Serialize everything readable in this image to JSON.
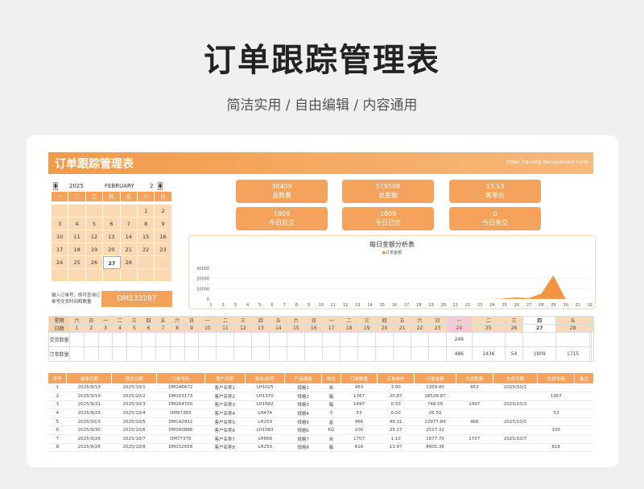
{
  "page": {
    "title": "订单跟踪管理表",
    "subtitle": "简洁实用 / 自由编辑 / 内容通用"
  },
  "sheet": {
    "title": "订单跟踪管理表",
    "title_en": "Order Tracking Management Form"
  },
  "calendar": {
    "year": "2025",
    "month": "FEBRUARY",
    "month_num": "2",
    "weekdays": [
      "一",
      "二",
      "三",
      "四",
      "五",
      "六",
      "日"
    ],
    "weeks": [
      [
        "",
        "",
        "",
        "",
        "",
        "1",
        "2"
      ],
      [
        "3",
        "4",
        "5",
        "6",
        "7",
        "8",
        "9"
      ],
      [
        "10",
        "11",
        "12",
        "13",
        "14",
        "15",
        "16"
      ],
      [
        "17",
        "18",
        "19",
        "20",
        "21",
        "22",
        "23"
      ],
      [
        "24",
        "25",
        "26",
        "27",
        "28",
        "",
        ""
      ],
      [
        "",
        "",
        "",
        "",
        "",
        "",
        ""
      ]
    ],
    "today": "27"
  },
  "lookup": {
    "label": "输入订单号，即可查询订单号交货时间和数量",
    "value": "DM133287"
  },
  "stats": [
    {
      "value": "38409",
      "label": "总数量"
    },
    {
      "value": "519508",
      "label": "总金额"
    },
    {
      "value": "13.53",
      "label": "客单价"
    },
    {
      "value": "1809",
      "label": "今日应交"
    },
    {
      "value": "1809",
      "label": "今日已交"
    },
    {
      "value": "0",
      "label": "今日未交"
    }
  ],
  "chart_data": {
    "type": "area",
    "title": "每日金额分析表",
    "legend": [
      "订单金额"
    ],
    "x": [
      "1",
      "2",
      "3",
      "4",
      "5",
      "6",
      "7",
      "8",
      "9",
      "10",
      "11",
      "12",
      "13",
      "14",
      "15",
      "16",
      "17",
      "18",
      "19",
      "20",
      "21",
      "22",
      "23",
      "24",
      "25",
      "26",
      "27",
      "28",
      "29",
      "30",
      "31",
      "32"
    ],
    "series": [
      {
        "name": "订单金额",
        "values": [
          0,
          0,
          0,
          0,
          0,
          0,
          0,
          0,
          0,
          0,
          0,
          0,
          0,
          0,
          0,
          0,
          0,
          0,
          0,
          0,
          0,
          0,
          0,
          0,
          500,
          1500,
          800,
          5000,
          23000,
          0,
          0,
          0
        ]
      }
    ],
    "yticks": [
      "0",
      "10000",
      "20000",
      "30000"
    ],
    "ylim": [
      0,
      30000
    ],
    "color": "#ef8a2f"
  },
  "tracking": {
    "week_label": "星期",
    "date_label": "日期",
    "due_label": "交货数量",
    "order_label": "订单数量",
    "weekdays": [
      "六",
      "日",
      "一",
      "二",
      "三",
      "四",
      "五",
      "六",
      "日",
      "一",
      "二",
      "三",
      "四",
      "五",
      "六",
      "日",
      "一",
      "二",
      "三",
      "四",
      "五",
      "六",
      "日",
      "一",
      "二",
      "三",
      "四",
      "五",
      "",
      ""
    ],
    "dates": [
      "1",
      "2",
      "3",
      "4",
      "5",
      "6",
      "7",
      "8",
      "9",
      "10",
      "11",
      "12",
      "13",
      "14",
      "15",
      "16",
      "17",
      "18",
      "19",
      "20",
      "21",
      "22",
      "23",
      "24",
      "25",
      "26",
      "27",
      "28",
      "",
      ""
    ],
    "due": [
      "",
      "",
      "",
      "",
      "",
      "",
      "",
      "",
      "",
      "",
      "",
      "",
      "",
      "",
      "",
      "",
      "",
      "",
      "",
      "",
      "",
      "",
      "",
      "246",
      "",
      "",
      "",
      "",
      "",
      ""
    ],
    "orders": [
      "",
      "",
      "",
      "",
      "",
      "",
      "",
      "",
      "",
      "",
      "",
      "",
      "",
      "",
      "",
      "",
      "",
      "",
      "",
      "",
      "",
      "",
      "",
      "486",
      "1436",
      "54",
      "1809",
      "1715",
      "",
      ""
    ]
  },
  "orders": {
    "headers": [
      "序号",
      "接单日期",
      "预交日期",
      "订单号码",
      "客户名称",
      "款名/料号",
      "产品规格",
      "单位",
      "订单数量",
      "订单单价",
      "订单金额",
      "交货数量",
      "交货日期",
      "交货未接",
      "备注"
    ],
    "rows": [
      [
        "1",
        "2025/9/19",
        "2025/10/1",
        "DM146672",
        "客户名称1",
        "LH1025",
        "规格1",
        "米",
        "453",
        "3.00",
        "1359.00",
        "453",
        "2025/10/1",
        "",
        ""
      ],
      [
        "2",
        "2025/9/19",
        "2025/10/2",
        "DM103173",
        "客户名称2",
        "LH1370",
        "规格2",
        "箱",
        "1367",
        "20.87",
        "28528.87",
        "",
        "",
        "1367",
        ""
      ],
      [
        "3",
        "2025/9/21",
        "2025/10/3",
        "DM164700",
        "客户名称3",
        "LH1682",
        "规格3",
        "箱",
        "1497",
        "0.50",
        "748.50",
        "1497",
        "2025/10/3",
        "",
        ""
      ],
      [
        "4",
        "2025/9/29",
        "2025/10/4",
        "DM97383",
        "客户名称4",
        "LH474",
        "规格4",
        "个",
        "53",
        "0.50",
        "26.50",
        "",
        "",
        "53",
        ""
      ],
      [
        "5",
        "2025/10/3",
        "2025/10/5",
        "DM142932",
        "客户名称5",
        "LH259",
        "规格5",
        "盒",
        "466",
        "49.31",
        "22977.84",
        "466",
        "2025/10/5",
        "",
        ""
      ],
      [
        "6",
        "2025/9/30",
        "2025/10/6",
        "DM160888",
        "客户名称6",
        "LH1083",
        "规格6",
        "KG",
        "100",
        "25.27",
        "2527.32",
        "",
        "",
        "100",
        ""
      ],
      [
        "7",
        "2025/9/26",
        "2025/10/7",
        "DM77376",
        "客户名称7",
        "LH668",
        "规格7",
        "米",
        "1707",
        "1.10",
        "1877.70",
        "1707",
        "2025/10/7",
        "",
        ""
      ],
      [
        "8",
        "2025/9/28",
        "2025/10/8",
        "DM152658",
        "客户名称8",
        "LH250",
        "规格8",
        "箱",
        "616",
        "13.97",
        "8605.38",
        "",
        "",
        "616",
        ""
      ]
    ]
  }
}
